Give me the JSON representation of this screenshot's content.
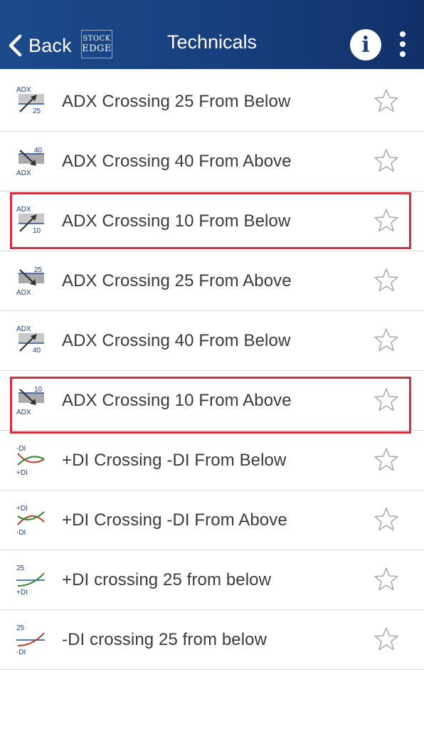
{
  "header": {
    "back_label": "Back",
    "logo_line1": "STOCK",
    "logo_line2": "EDGE",
    "title": "Technicals",
    "info_glyph": "i",
    "bg_color": "#173f7c"
  },
  "scans": [
    {
      "label": "ADX Crossing 25 From Below",
      "icon": "adx-cross-up",
      "top": "ADX",
      "bottom": "25",
      "favorite": false
    },
    {
      "label": "ADX Crossing 40 From Above",
      "icon": "adx-cross-down",
      "top": "40",
      "bottom": "ADX",
      "favorite": false
    },
    {
      "label": "ADX Crossing 10 From Below",
      "icon": "adx-cross-up",
      "top": "ADX",
      "bottom": "10",
      "favorite": false
    },
    {
      "label": "ADX Crossing 25 From Above",
      "icon": "adx-cross-down",
      "top": "25",
      "bottom": "ADX",
      "favorite": false
    },
    {
      "label": "ADX Crossing 40 From Below",
      "icon": "adx-cross-up",
      "top": "ADX",
      "bottom": "40",
      "favorite": false
    },
    {
      "label": "ADX Crossing 10 From Above",
      "icon": "adx-cross-down",
      "top": "10",
      "bottom": "ADX",
      "favorite": false
    },
    {
      "label": "+DI Crossing -DI From Below",
      "icon": "di-cross-below",
      "top": "-DI",
      "bottom": "+DI",
      "favorite": false
    },
    {
      "label": "+DI Crossing -DI From Above",
      "icon": "di-cross-above",
      "top": "+DI",
      "bottom": "-DI",
      "favorite": false
    },
    {
      "label": "+DI crossing 25 from below",
      "icon": "plus-di-cross-level",
      "top": "25",
      "bottom": "+DI",
      "favorite": false
    },
    {
      "label": "-DI crossing 25 from below",
      "icon": "minus-di-cross-level",
      "top": "25",
      "bottom": "-DI",
      "favorite": false
    }
  ],
  "highlight_color": "#d0313d",
  "label_color": "#3a3a3a"
}
